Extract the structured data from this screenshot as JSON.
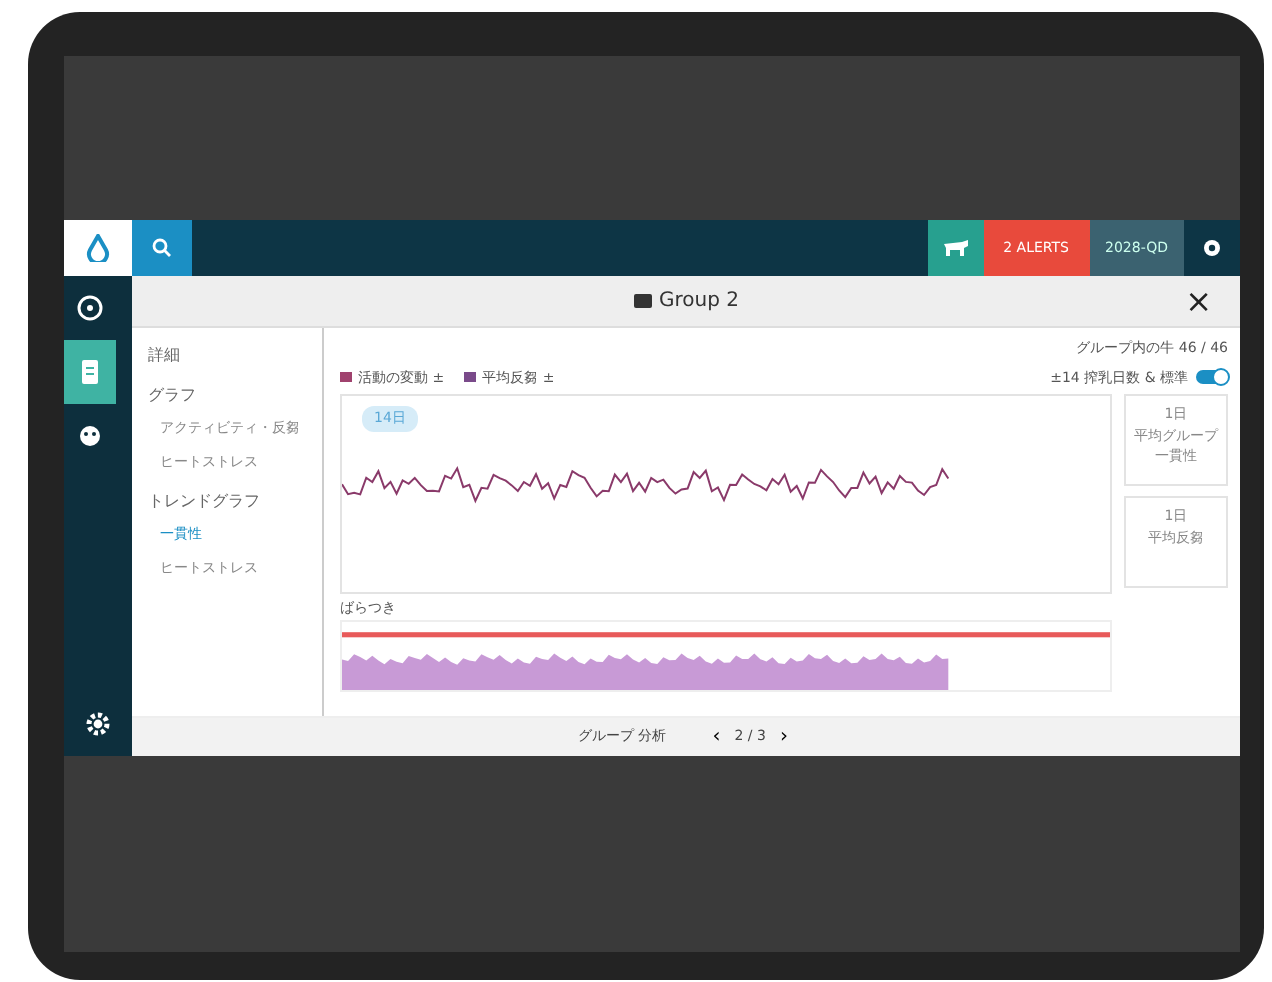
{
  "navbar": {
    "alerts": "2 ALERTS",
    "user": "2028-QD"
  },
  "rail": [
    {
      "selected": false
    },
    {
      "selected": true
    },
    {
      "selected": false
    }
  ],
  "modal": {
    "title": "Group 2",
    "close": "×"
  },
  "menu": [
    {
      "label": "詳細"
    },
    {
      "label": "グラフ",
      "children": [
        {
          "label": "アクティビティ・反芻",
          "selected": false
        },
        {
          "label": "ヒートストレス",
          "selected": false
        }
      ]
    },
    {
      "label": "トレンドグラフ",
      "children": [
        {
          "label": "一貫性",
          "selected": true
        },
        {
          "label": "ヒートストレス",
          "selected": false
        }
      ]
    }
  ],
  "legend": [
    {
      "label": "活動の変動 ±",
      "color": "#a0426e"
    },
    {
      "label": "平均反芻 ±",
      "color": "#7a4a8a"
    }
  ],
  "cows_in_group": "グループ内の牛 46 / 46",
  "toggle": {
    "label": "±14 搾乳日数 & 標準",
    "on": true
  },
  "chip": "14日",
  "lower_title": "ばらつき",
  "side_cards": [
    {
      "lines": [
        "1日",
        "平均グループ",
        "一貫性"
      ]
    },
    {
      "lines": [
        "1日",
        "平均反芻"
      ]
    }
  ],
  "footer": {
    "label": "グループ 分析",
    "prev": "‹",
    "pager": "2 / 3",
    "next": "›"
  }
}
